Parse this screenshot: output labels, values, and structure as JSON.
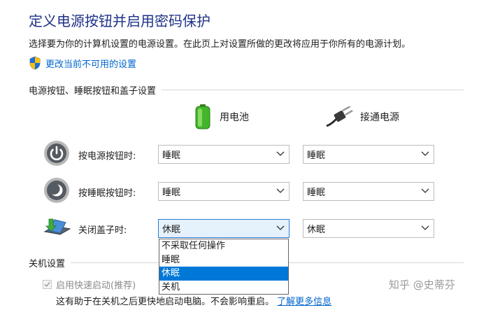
{
  "page": {
    "title": "定义电源按钮并启用密码保护",
    "description": "选择要为你的计算机设置的电源设置。在此页上对设置所做的更改将应用于你所有的电源计划。",
    "change_settings_link": "更改当前不可用的设置"
  },
  "buttons_section": {
    "header": "电源按钮、睡眠按钮和盖子设置",
    "columns": {
      "battery": "用电池",
      "plugged_in": "接通电源"
    },
    "rows": [
      {
        "label": "按电源按钮时:",
        "battery": "睡眠",
        "plugged_in": "睡眠",
        "icon": "power-button-icon"
      },
      {
        "label": "按睡眠按钮时:",
        "battery": "睡眠",
        "plugged_in": "睡眠",
        "icon": "sleep-button-icon"
      },
      {
        "label": "关闭盖子时:",
        "battery": "休眠",
        "plugged_in": "休眠",
        "icon": "laptop-lid-icon"
      }
    ]
  },
  "dropdown_open": {
    "options": [
      "不采取任何操作",
      "睡眠",
      "休眠",
      "关机"
    ],
    "selected": "休眠"
  },
  "shutdown_section": {
    "header": "关机设置",
    "fast_startup_label": "启用快速启动(推荐)",
    "fast_startup_checked": true,
    "fast_startup_help": "这有助于在关机之后更快地启动电脑。不会影响重启。",
    "learn_more_link": "了解更多信息"
  },
  "watermark": "知乎 @史蒂芬",
  "colors": {
    "title": "#1e3287",
    "link": "#0066cc",
    "selection": "#0078d7",
    "dropdown_open_bg": "#e5f1fb"
  }
}
